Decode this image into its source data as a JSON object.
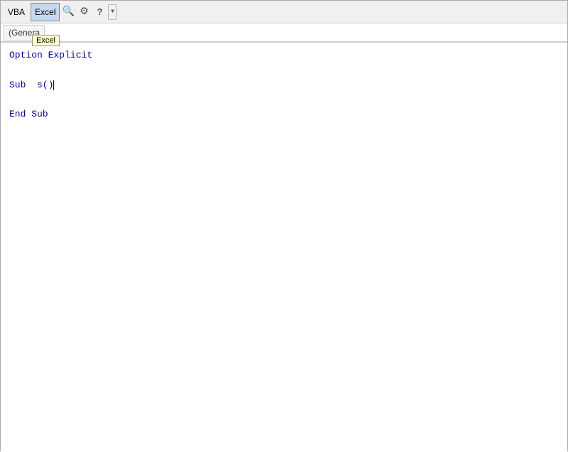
{
  "toolbar": {
    "vba_label": "VBA",
    "excel_label": "Excel",
    "search_icon": "🔍",
    "gear_icon": "⚙",
    "help_icon": "?",
    "dropdown_arrow": "▼"
  },
  "tooltip": {
    "text": "Excel"
  },
  "breadcrumb": {
    "label": "(Genera"
  },
  "code": {
    "line1": "Option Explicit",
    "line2": "",
    "line3": "Sub  s()",
    "line4": "",
    "line5": "End Sub"
  }
}
